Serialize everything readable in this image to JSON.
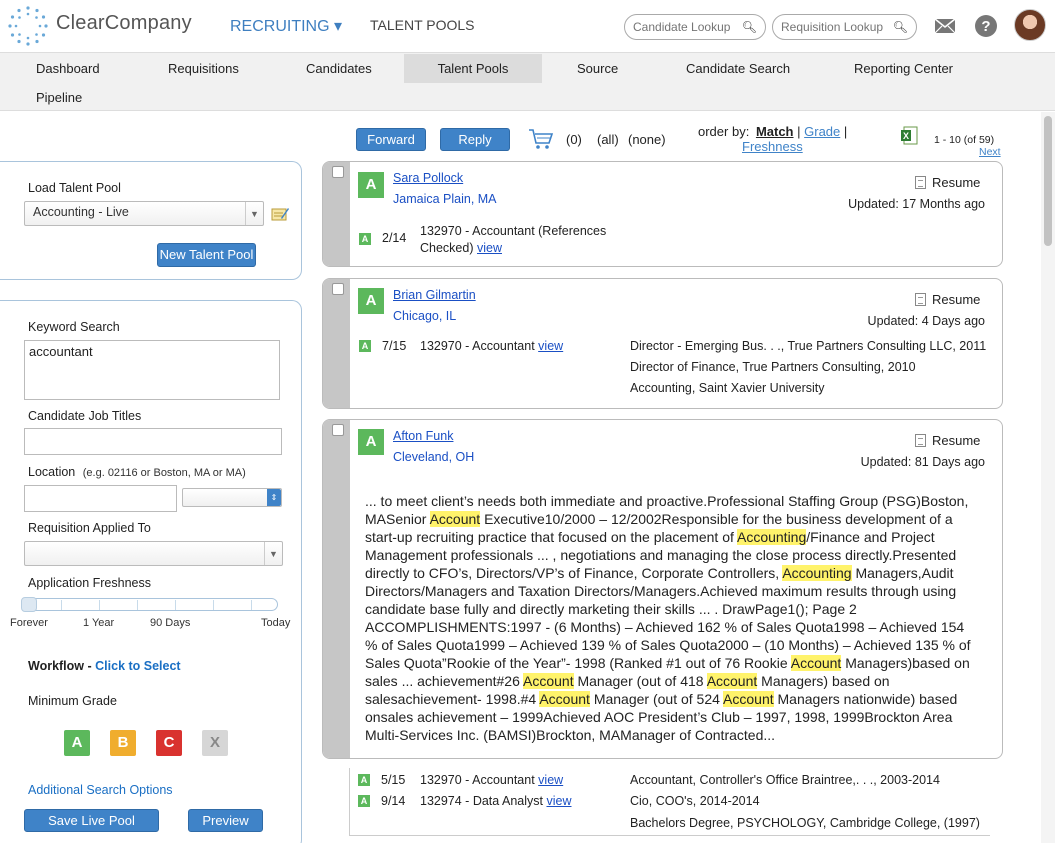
{
  "header": {
    "brand": "ClearCompany",
    "nav_recruiting": "RECRUITING ▾",
    "nav_talent_pools": "TALENT POOLS",
    "candidate_lookup_placeholder": "Candidate Lookup",
    "requisition_lookup_placeholder": "Requisition Lookup",
    "icons": [
      "logo-icon",
      "search-icon",
      "mail-icon",
      "help-icon",
      "avatar"
    ]
  },
  "tabs": [
    "Dashboard",
    "Requisitions",
    "Candidates",
    "Talent Pools",
    "Source",
    "Candidate Search",
    "Reporting Center",
    "Pipeline"
  ],
  "active_tab": "Talent Pools",
  "toolbar": {
    "forward": "Forward",
    "reply": "Reply",
    "cart_count": "(0)",
    "all": "(all)",
    "none": "(none)",
    "order_by": "order by:",
    "match": "Match",
    "grade": "Grade",
    "sep": "|",
    "freshness": "Freshness",
    "pagination": "1 - 10 (of 59)",
    "next": "Next"
  },
  "left": {
    "load_label": "Load Talent Pool",
    "pool_value": "Accounting - Live",
    "new_pool": "New Talent Pool",
    "keyword_label": "Keyword Search",
    "keyword_value": "accountant",
    "job_titles_label": "Candidate Job Titles",
    "location_label": "Location",
    "location_hint": "(e.g. 02116 or Boston, MA or MA)",
    "requisition_label": "Requisition Applied To",
    "freshness_label": "Application Freshness",
    "fresh_ticks": [
      "Forever",
      "1 Year",
      "90 Days",
      "Today"
    ],
    "workflow_label": "Workflow -",
    "workflow_link": "Click to Select",
    "min_grade_label": "Minimum Grade",
    "grades": [
      "A",
      "B",
      "C",
      "X"
    ],
    "additional": "Additional Search Options",
    "save": "Save Live Pool",
    "preview": "Preview"
  },
  "results": [
    {
      "grade": "A",
      "name": "Sara Pollock",
      "location": "Jamaica Plain, MA",
      "resume": "Resume",
      "updated": "Updated: 17 Months ago",
      "reqs": [
        {
          "grade": "A",
          "score": "2/14",
          "text1": "132970 - Accountant (References",
          "text2": "Checked)",
          "view": "view"
        }
      ]
    },
    {
      "grade": "A",
      "name": "Brian Gilmartin",
      "location": "Chicago, IL",
      "resume": "Resume",
      "updated": "Updated: 4 Days ago",
      "reqs": [
        {
          "grade": "A",
          "score": "7/15",
          "text1": "132970 - Accountant",
          "view": "view"
        }
      ],
      "history": [
        "Director - Emerging Bus. . ., True Partners Consulting LLC, 2011",
        "Director of Finance, True Partners Consulting, 2010",
        "Accounting, Saint Xavier University"
      ]
    },
    {
      "grade": "A",
      "name": "Afton Funk",
      "location": "Cleveland, OH",
      "resume": "Resume",
      "updated": "Updated: 81 Days ago",
      "excerpt": [
        "... to meet client’s needs both immediate and proactive.Professional Staffing Group (PSG)Boston, MASenior ",
        {
          "hl": "Account"
        },
        " Executive10/2000 – 12/2002Responsible for the business development of a start-up recruiting practice that focused on the placement of ",
        {
          "hl": "Accounting"
        },
        "/Finance and Project Management professionals ... , negotiations and managing the close process directly.Presented directly to CFO’s, Directors/VP’s of Finance, Corporate Controllers, ",
        {
          "hl": "Accounting"
        },
        " Managers,Audit Directors/Managers and Taxation Directors/Managers.Achieved maximum results through using candidate base fully and directly marketing their skills ... . DrawPage1(); Page 2 ACCOMPLISHMENTS:1997 - (6 Months) – Achieved 162 % of Sales Quota1998 – Achieved 154 % of Sales Quota1999 – Achieved 139 % of Sales Quota2000 – (10 Months) – Achieved 135 % of Sales Quota”Rookie of the Year”- 1998 (Ranked #1 out of 76 Rookie ",
        {
          "hl": "Account"
        },
        " Managers)based on sales ... achievement#26 ",
        {
          "hl": "Account"
        },
        " Manager (out of 418 ",
        {
          "hl": "Account"
        },
        " Managers) based on salesachievement- 1998.#4 ",
        {
          "hl": "Account"
        },
        " Manager (out of 524 ",
        {
          "hl": "Account"
        },
        " Managers nationwide) based onsales achievement – 1999Achieved AOC President’s Club – 1997, 1998, 1999Brockton Area Multi-Services Inc. (BAMSI)Brockton, MAManager of Contracted..."
      ],
      "reqs": [
        {
          "grade": "A",
          "score": "5/15",
          "text1": "132970 - Accountant",
          "view": "view"
        },
        {
          "grade": "A",
          "score": "9/14",
          "text1": "132974 - Data Analyst",
          "view": "view"
        }
      ],
      "history": [
        "Accountant, Controller's Office Braintree,. . ., 2003-2014",
        "Cio, COO's, 2014-2014",
        "Bachelors Degree, PSYCHOLOGY, Cambridge College, (1997)"
      ]
    }
  ]
}
